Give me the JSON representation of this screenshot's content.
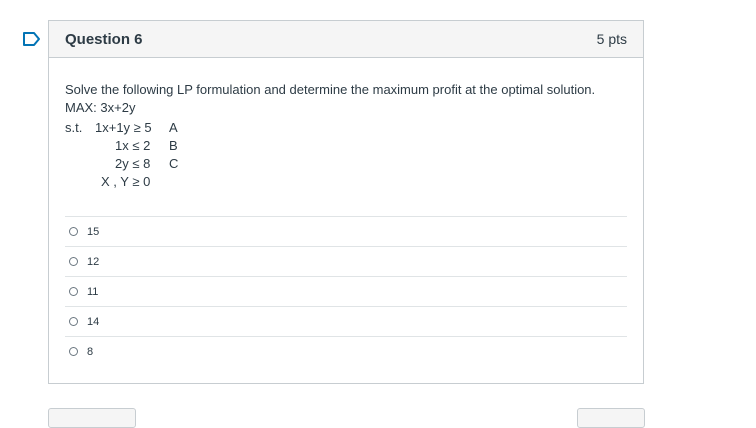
{
  "question": {
    "title": "Question 6",
    "points": "5 pts",
    "prompt": "Solve the following LP formulation and determine the maximum profit at the optimal solution.",
    "objective": "MAX: 3x+2y",
    "constraints": {
      "st_label": "s.t.",
      "c1_expr": "1x+1y ≥ 5",
      "c1_tag": "A",
      "c2_expr": "1x ≤ 2",
      "c2_tag": "B",
      "c3_expr": "2y ≤ 8",
      "c3_tag": "C",
      "nonneg": "X , Y ≥ 0"
    }
  },
  "answers": [
    "15",
    "12",
    "11",
    "14",
    "8"
  ],
  "icons": {
    "flag": "flag-outline-icon",
    "radio": "radio-button-icon"
  },
  "colors": {
    "accent": "#0374b5",
    "border": "#c7cdd1",
    "header_bg": "#f5f5f5",
    "text": "#2d3b45"
  }
}
